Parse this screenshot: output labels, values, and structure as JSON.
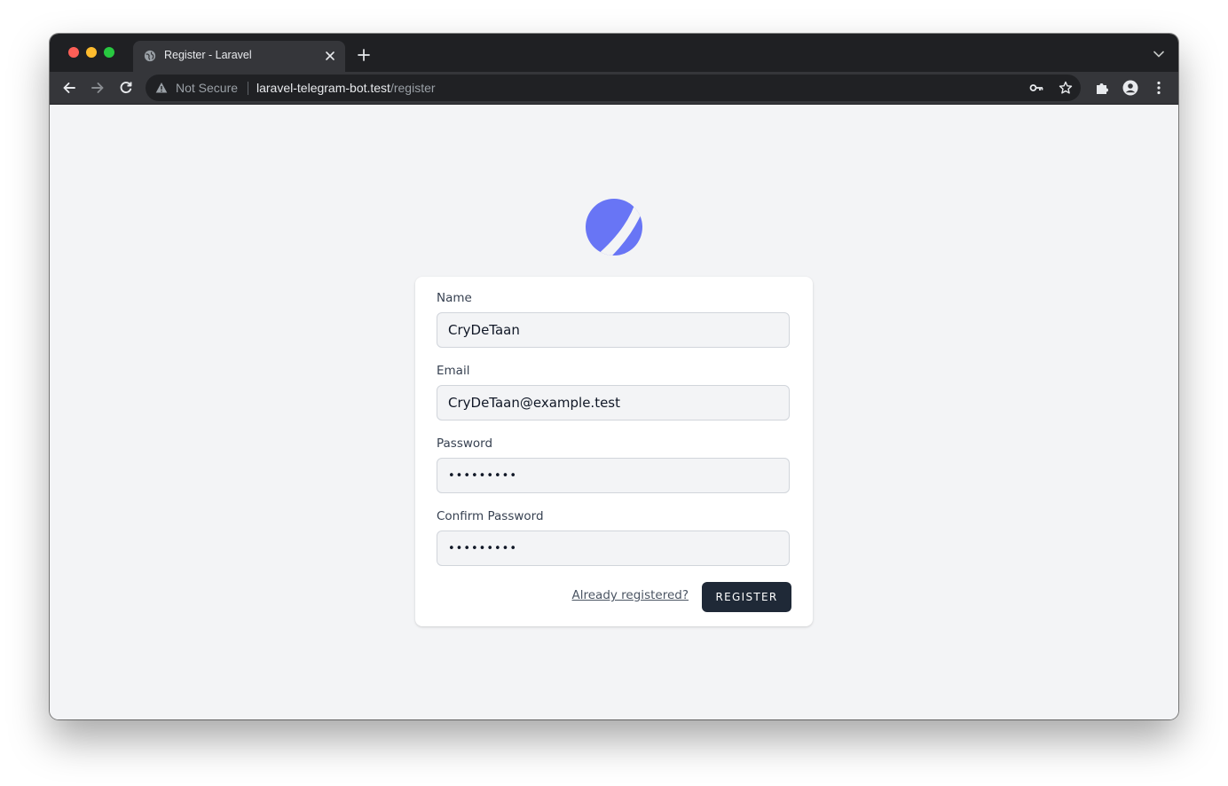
{
  "browser": {
    "tab": {
      "title": "Register - Laravel",
      "favicon_icon": "globe-icon"
    },
    "address_bar": {
      "security_label": "Not Secure",
      "host": "laravel-telegram-bot.test",
      "path": "/register"
    },
    "colors": {
      "tab_strip": "#1f2023",
      "toolbar": "#35363a",
      "omnibox": "#202124"
    }
  },
  "page": {
    "logo_icon": "laravel-breeze-logo-icon",
    "logo_color": "#6875f5",
    "form": {
      "name": {
        "label": "Name",
        "value": "CryDeTaan"
      },
      "email": {
        "label": "Email",
        "value": "CryDeTaan@example.test"
      },
      "password": {
        "label": "Password",
        "value": "•••••••••"
      },
      "password_confirmation": {
        "label": "Confirm Password",
        "value": "•••••••••"
      },
      "login_link": "Already registered?",
      "submit_label": "REGISTER"
    },
    "colors": {
      "background": "#f3f4f6",
      "card": "#ffffff",
      "button": "#1f2937"
    }
  }
}
